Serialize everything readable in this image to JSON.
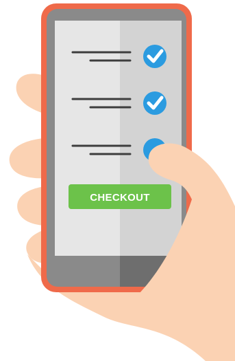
{
  "checkout_button": {
    "label": "CHECKOUT"
  },
  "checklist": {
    "items": [
      {
        "checked": true
      },
      {
        "checked": true
      },
      {
        "checked": false
      }
    ]
  },
  "colors": {
    "phone_frame": "#ef6a4a",
    "screen": "#e6e6e6",
    "screen_shadow": "#d3d3d3",
    "bezel": "#8a8a8a",
    "check_blue": "#2b9be0",
    "button_green": "#6cc24a",
    "skin": "#fbd2b3",
    "text_lines": "#3d3d3d"
  },
  "icons": {
    "item_1": "check-circle-icon",
    "item_2": "check-circle-icon",
    "item_3": "empty-circle-icon"
  }
}
